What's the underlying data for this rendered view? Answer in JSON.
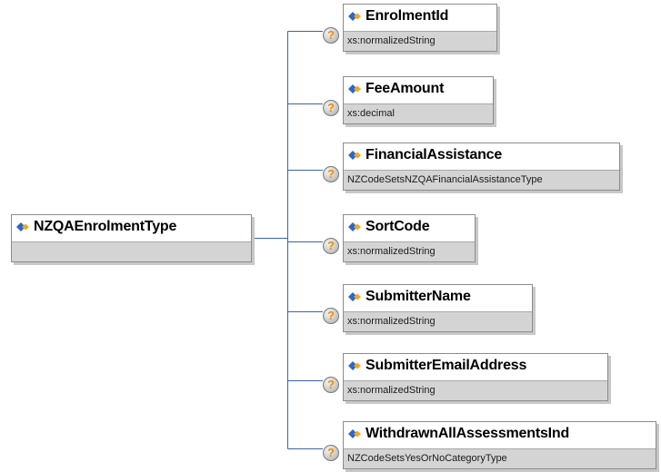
{
  "root": {
    "name": "NZQAEnrolmentType",
    "type": ""
  },
  "help_glyph": "?",
  "icons": {
    "element": "element-diamond-icon",
    "help": "question-mark-icon"
  },
  "colors": {
    "connector": "#3b64a4",
    "icon_blue": "#2b67c6",
    "icon_orange": "#f5a623",
    "type_band": "#d4d4d4",
    "help_glyph": "#f08a00"
  },
  "children": [
    {
      "name": "EnrolmentId",
      "type": "xs:normalizedString"
    },
    {
      "name": "FeeAmount",
      "type": "xs:decimal"
    },
    {
      "name": "FinancialAssistance",
      "type": "NZCodeSetsNZQAFinancialAssistanceType"
    },
    {
      "name": "SortCode",
      "type": "xs:normalizedString"
    },
    {
      "name": "SubmitterName",
      "type": "xs:normalizedString"
    },
    {
      "name": "SubmitterEmailAddress",
      "type": "xs:normalizedString"
    },
    {
      "name": "WithdrawnAllAssessmentsInd",
      "type": "NZCodeSetsYesOrNoCategoryType"
    }
  ]
}
